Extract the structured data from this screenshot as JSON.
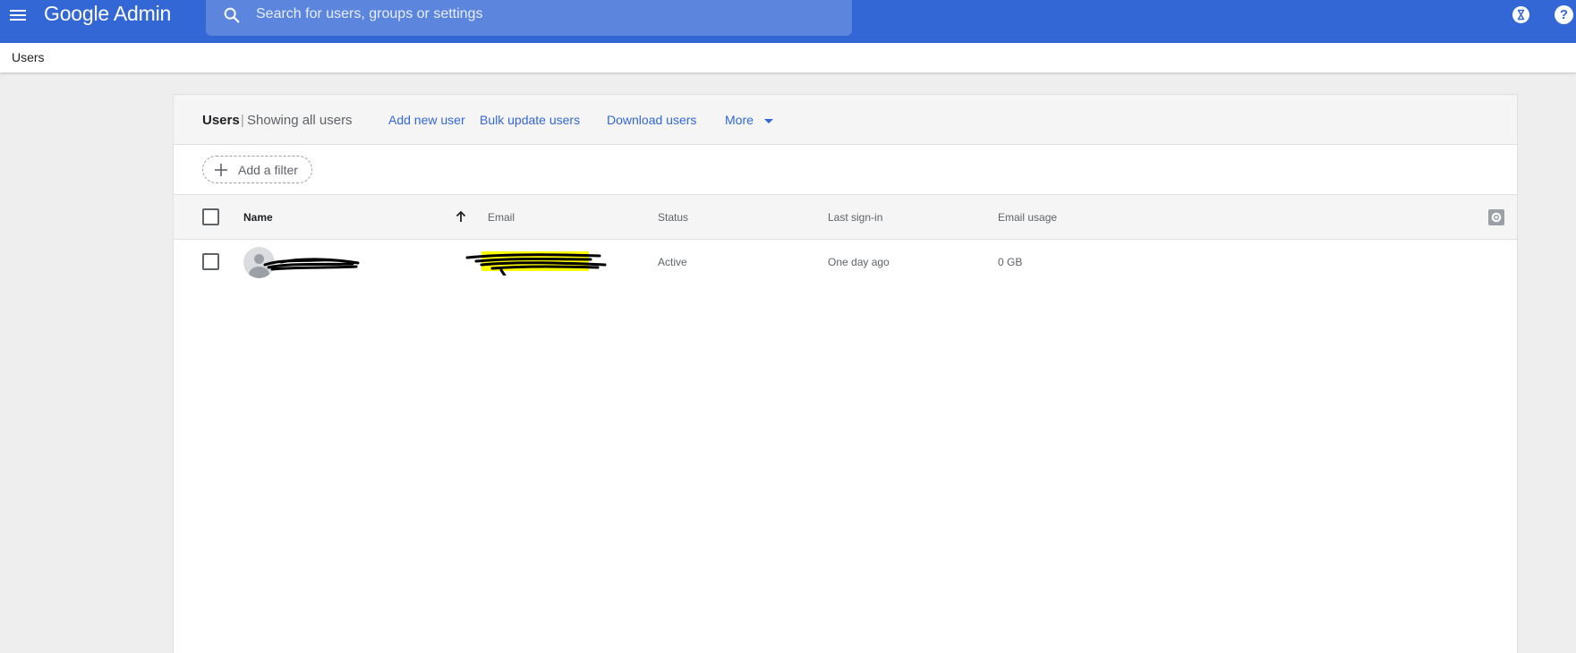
{
  "appbar": {
    "product": "Google Admin",
    "search_placeholder": "Search for users, groups or settings",
    "color": "#3367d6",
    "icons": [
      "menu-icon",
      "search-icon",
      "hourglass-icon",
      "help-icon"
    ]
  },
  "breadcrumb": {
    "current": "Users"
  },
  "panel": {
    "title": "Users",
    "separator": "|",
    "subtitle": "Showing all users",
    "actions": {
      "add_user": "Add new user",
      "bulk_update": "Bulk update users",
      "download": "Download users",
      "more": "More"
    },
    "filter_label": "Add a filter"
  },
  "table": {
    "columns": {
      "name": "Name",
      "email": "Email",
      "status": "Status",
      "last_signin": "Last sign-in",
      "email_usage": "Email usage"
    },
    "sort": {
      "column": "Name",
      "direction": "ascending"
    },
    "rows": [
      {
        "status": "Active",
        "last_signin": "One day ago",
        "email_usage": "0 GB"
      }
    ]
  }
}
